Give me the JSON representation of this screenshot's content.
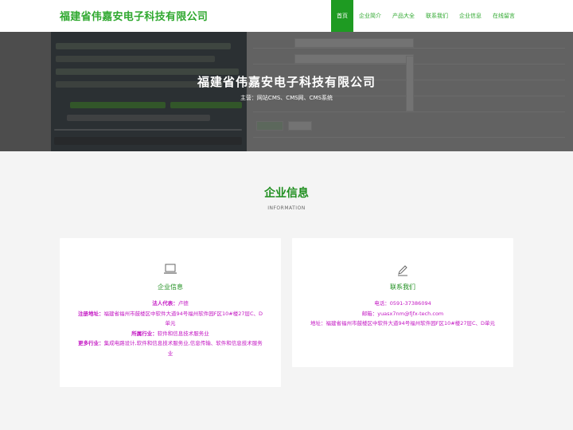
{
  "header": {
    "logo": "福建省伟嘉安电子科技有限公司",
    "nav": [
      {
        "label": "首页",
        "active": true
      },
      {
        "label": "企业简介",
        "active": false
      },
      {
        "label": "产品大全",
        "active": false
      },
      {
        "label": "联系我们",
        "active": false
      },
      {
        "label": "企业信息",
        "active": false
      },
      {
        "label": "在线留言",
        "active": false
      }
    ]
  },
  "hero": {
    "title": "福建省伟嘉安电子科技有限公司",
    "subtitle": "主营：网站CMS、CMS网、CMS系统"
  },
  "section": {
    "title": "企业信息",
    "subtitle": "INFORMATION"
  },
  "company_card": {
    "icon": "laptop-icon",
    "title": "企业信息",
    "legal_label": "法人代表：",
    "legal_value": "卢德",
    "address_label": "注册地址：",
    "address_value": "福建省福州市鼓楼区中软件大道94号福州软件园F区10#楼27层C、D单元",
    "industry_label": "所属行业：",
    "industry_value": "软件和信息技术服务业",
    "more_label": "更多行业：",
    "more_value": "集成电路设计,软件和信息技术服务业,信息传输、软件和信息技术服务业"
  },
  "contact_card": {
    "icon": "pencil-icon",
    "title": "联系我们",
    "phone_label": "电话：",
    "phone_value": "0591-37386094",
    "email_label": "邮箱：",
    "email_value": "yuasx7nm@fjfx-tech.com",
    "addr_label": "地址：",
    "addr_value": "福建省福州市鼓楼区中软件大道94号福州软件园F区10#楼27层C、D单元"
  },
  "colors": {
    "brand_green": "#1e9b22",
    "accent_magenta": "#c316c3"
  }
}
